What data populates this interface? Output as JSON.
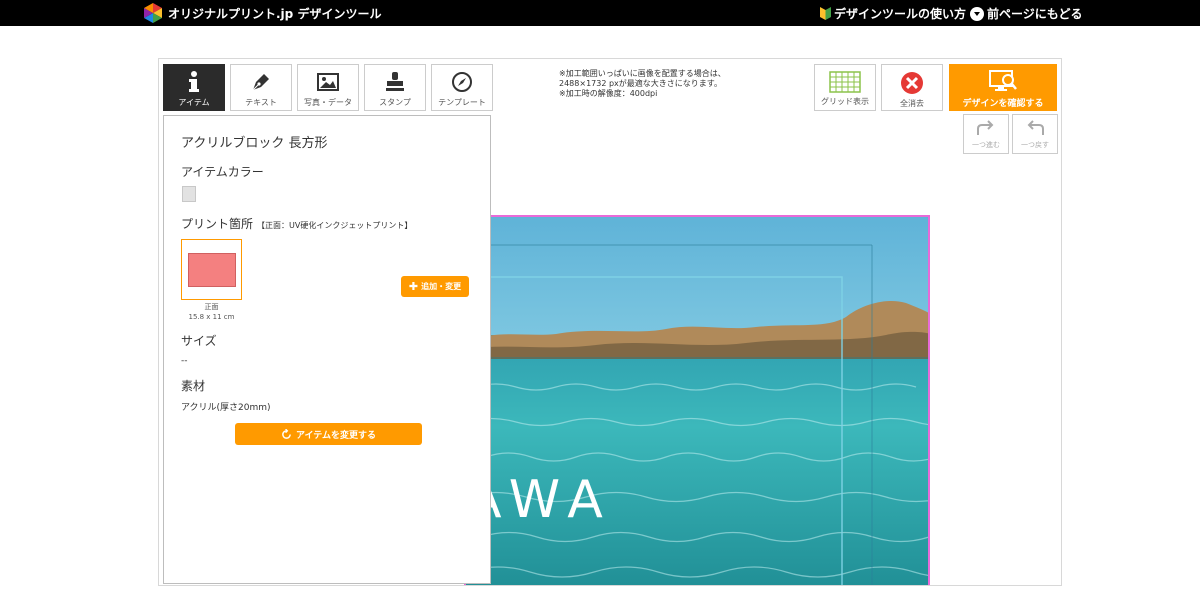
{
  "header": {
    "brand": "オリジナルプリント.jp デザインツール",
    "help_link": "デザインツールの使い方",
    "back_link": "前ページにもどる"
  },
  "toolbar": {
    "tools": [
      {
        "label": "アイテム",
        "icon": "info-icon",
        "active": true
      },
      {
        "label": "テキスト",
        "icon": "pen-icon",
        "active": false
      },
      {
        "label": "写真・データ",
        "icon": "image-icon",
        "active": false
      },
      {
        "label": "スタンプ",
        "icon": "stamp-icon",
        "active": false
      },
      {
        "label": "テンプレート",
        "icon": "compass-icon",
        "active": false
      }
    ],
    "notice_lines": [
      "※加工範囲いっぱいに画像を配置する場合は、",
      "2488×1732 pxが最適な大きさになります。",
      "※加工時の解像度：400dpi"
    ],
    "grid_label": "グリッド表示",
    "clear_label": "全消去",
    "confirm_label": "デザインを確認する",
    "redo_label": "一つ進む",
    "undo_label": "一つ戻す"
  },
  "panel": {
    "title": "アクリルブロック 長方形",
    "item_color_heading": "アイテムカラー",
    "item_color": "#e2e2e2",
    "print_area_heading": "プリント箇所",
    "print_method": "【正面：UV硬化インクジェットプリント】",
    "print_area_name": "正面",
    "print_area_size": "15.8 x 11 cm",
    "add_change_label": "追加・変更",
    "size_heading": "サイズ",
    "size_value": "--",
    "material_heading": "素材",
    "material_value": "アクリル(厚さ20mm)",
    "change_item_label": "アイテムを変更する"
  },
  "canvas": {
    "overlay_text": "AWA"
  },
  "colors": {
    "accent": "#ff9a00",
    "topbar": "#000000",
    "canvas_border": "#e86ad8",
    "active_tool": "#2b2b2b"
  }
}
